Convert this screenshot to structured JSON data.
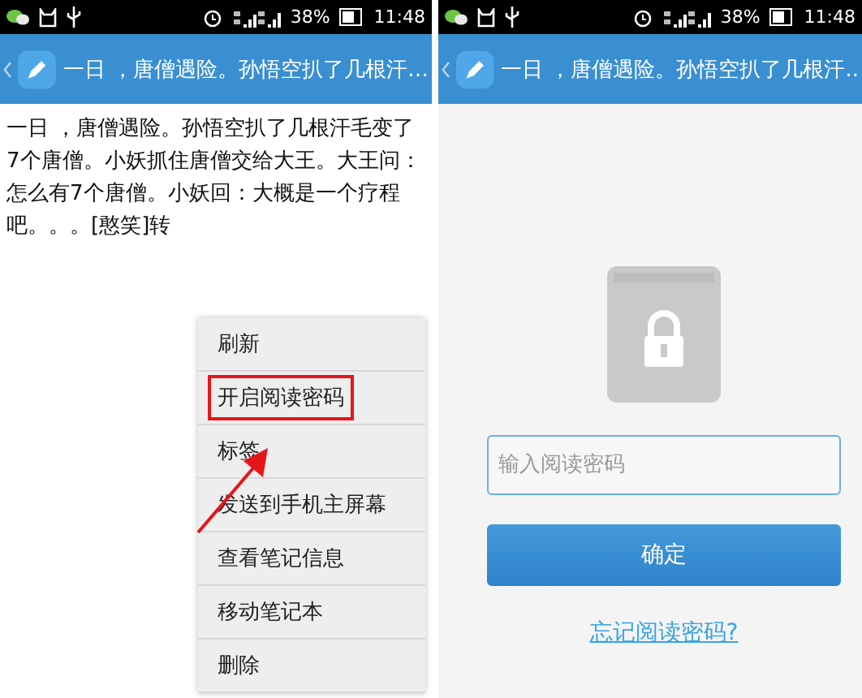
{
  "screens": [
    {
      "status_bar": {
        "battery": "38%",
        "time": "11:48"
      },
      "header": {
        "title": "一日 ，唐僧遇险。孙悟空扒了几根汗…"
      },
      "note_text": "一日 ，唐僧遇险。孙悟空扒了几根汗毛变了7个唐僧。小妖抓住唐僧交给大王。大王问：怎么有7个唐僧。小妖回：大概是一个疗程吧。。。[憨笑]转",
      "menu": [
        {
          "label": "刷新",
          "highlighted": false
        },
        {
          "label": "开启阅读密码",
          "highlighted": true
        },
        {
          "label": "标签",
          "highlighted": false
        },
        {
          "label": "发送到手机主屏幕",
          "highlighted": false
        },
        {
          "label": "查看笔记信息",
          "highlighted": false
        },
        {
          "label": "移动笔记本",
          "highlighted": false
        },
        {
          "label": "删除",
          "highlighted": false
        }
      ]
    },
    {
      "status_bar": {
        "battery": "38%",
        "time": "11:48"
      },
      "header": {
        "title": "一日 ，唐僧遇险。孙悟空扒了几根汗.."
      },
      "password_field": {
        "placeholder": "输入阅读密码"
      },
      "confirm_button": "确定",
      "forgot_link": "忘记阅读密码?"
    }
  ]
}
